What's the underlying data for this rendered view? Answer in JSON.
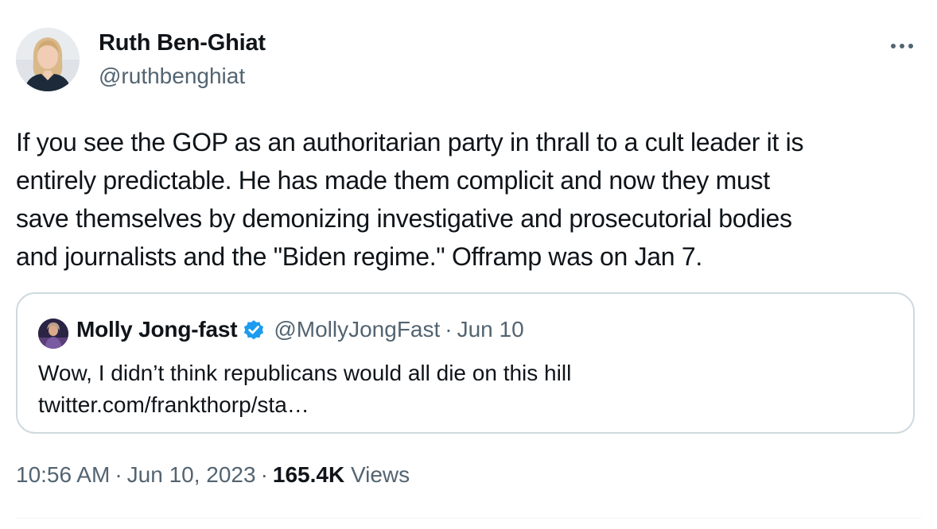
{
  "author": {
    "name": "Ruth Ben-Ghiat",
    "handle": "@ruthbenghiat"
  },
  "more_icon": "more-horizontal-icon",
  "tweet": {
    "lines": [
      "If you see the GOP as an authoritarian party in thrall to a cult leader it is",
      "entirely predictable. He has made them complicit and now they must",
      "save themselves by demonizing investigative and prosecutorial bodies",
      "and journalists and the \"Biden regime.\" Offramp was on Jan 7."
    ]
  },
  "quote": {
    "name": "Molly Jong-fast",
    "verified": true,
    "verified_icon": "verified-badge-icon",
    "handle": "@MollyJongFast",
    "separator": "·",
    "date": "Jun 10",
    "lines": [
      "Wow, I didn’t think republicans would all die on this hill",
      "twitter.com/frankthorp/sta…"
    ]
  },
  "meta": {
    "time": "10:56 AM",
    "separator": "·",
    "date": "Jun 10, 2023",
    "views_count": "165.4K",
    "views_label": "Views"
  },
  "colors": {
    "text": "#0f1419",
    "secondary": "#536471",
    "border": "#cfd9de",
    "verified": "#1d9bf0"
  }
}
